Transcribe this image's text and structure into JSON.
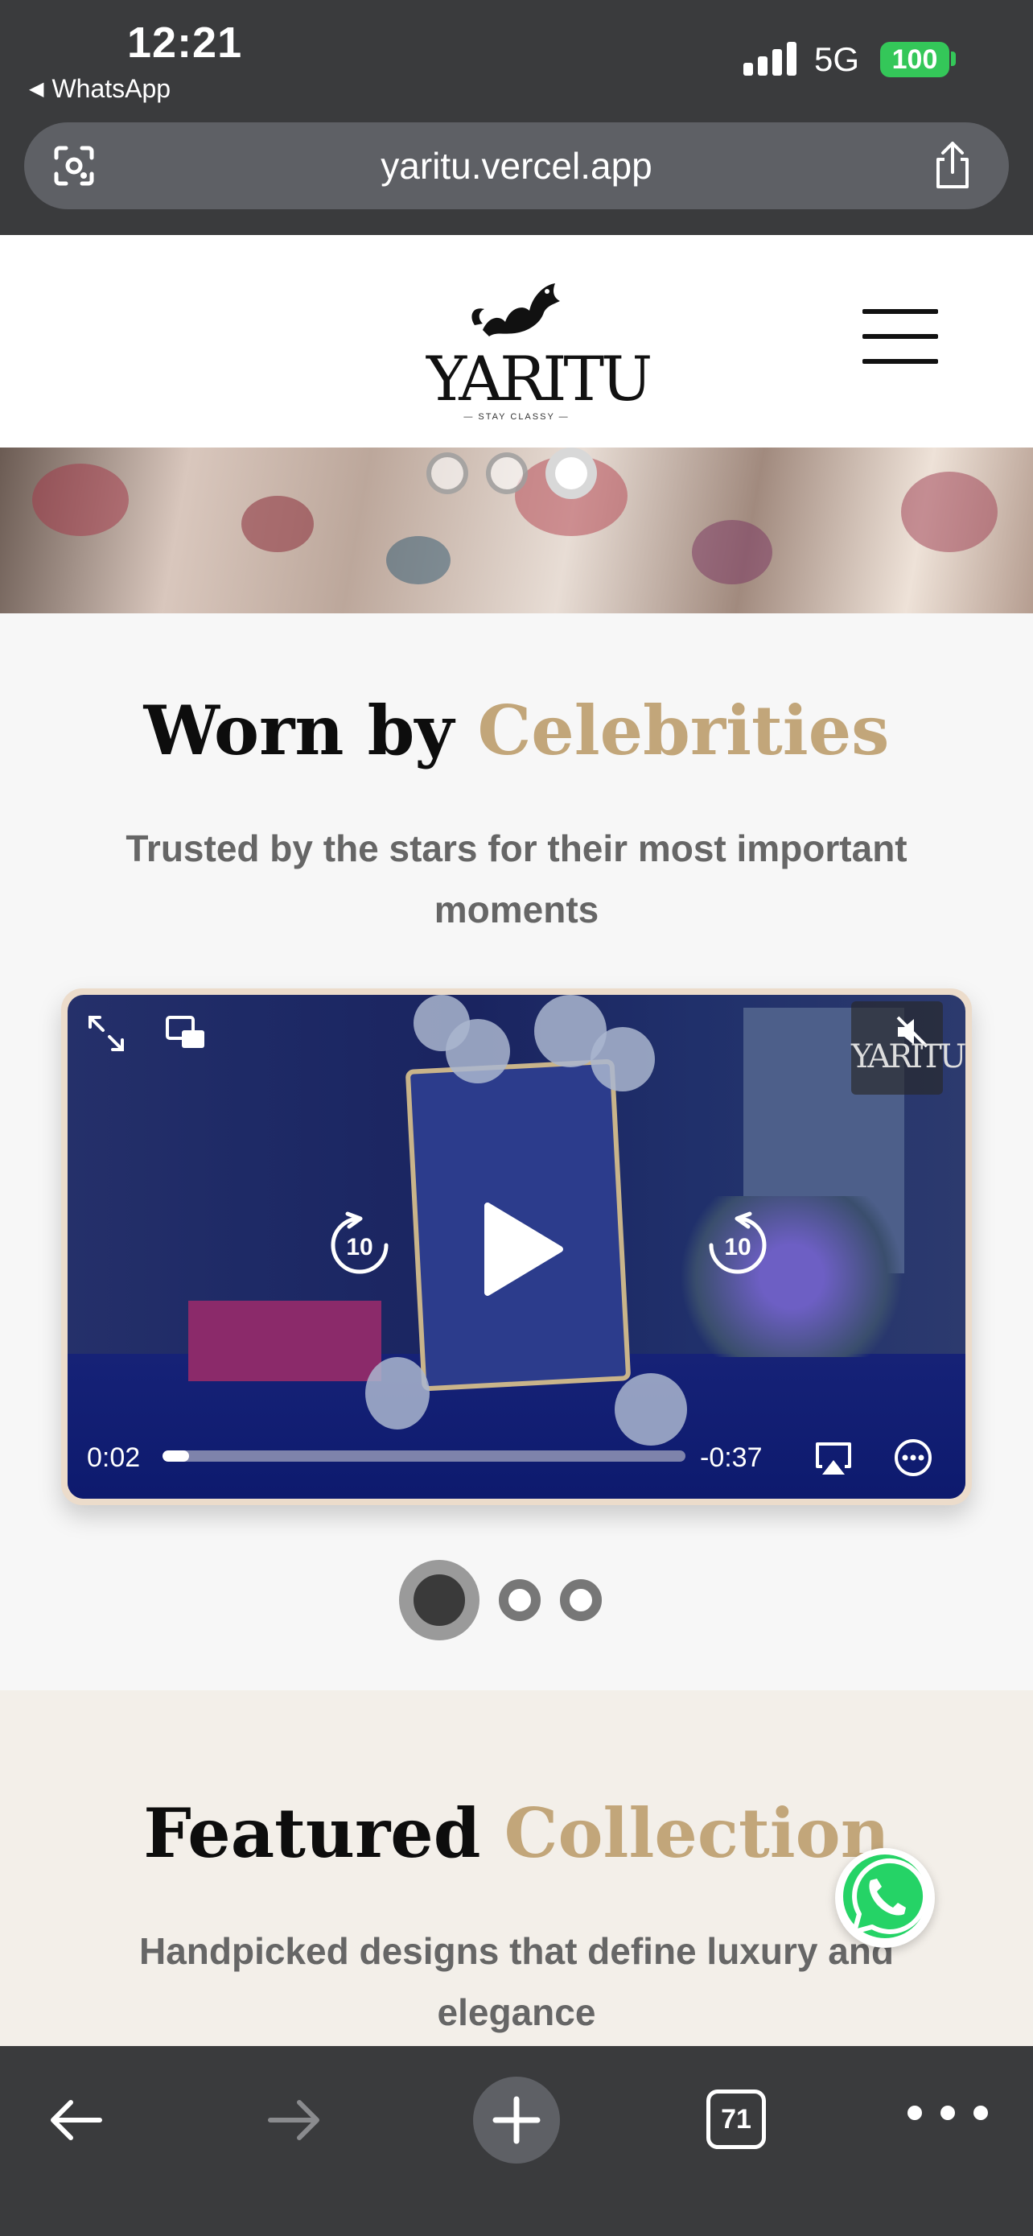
{
  "status": {
    "time": "12:21",
    "back_app": "WhatsApp",
    "network": "5G",
    "battery": "100"
  },
  "browser": {
    "url": "yaritu.vercel.app",
    "tab_count": "71"
  },
  "site": {
    "logo_word": "YARITU",
    "logo_tag": "— STAY CLASSY —"
  },
  "hero": {
    "slides": 3,
    "active_slide": 3
  },
  "celebrities": {
    "title_main": "Worn by ",
    "title_accent": "Celebrities",
    "subtitle": "Trusted by the stars for their most important moments",
    "video": {
      "current_time": "0:02",
      "remaining_time": "-0:37",
      "progress": 0.05,
      "muted_logo": "YARITU",
      "skip_back_seconds": "10",
      "skip_forward_seconds": "10"
    },
    "carousel": {
      "slides": 3,
      "active_slide": 1
    }
  },
  "featured": {
    "title_main": "Featured ",
    "title_accent": "Collection",
    "subtitle": "Handpicked designs that define luxury and elegance"
  },
  "colors": {
    "accent": "#c2a67a",
    "whatsapp": "#25d366",
    "battery": "#34c759"
  }
}
